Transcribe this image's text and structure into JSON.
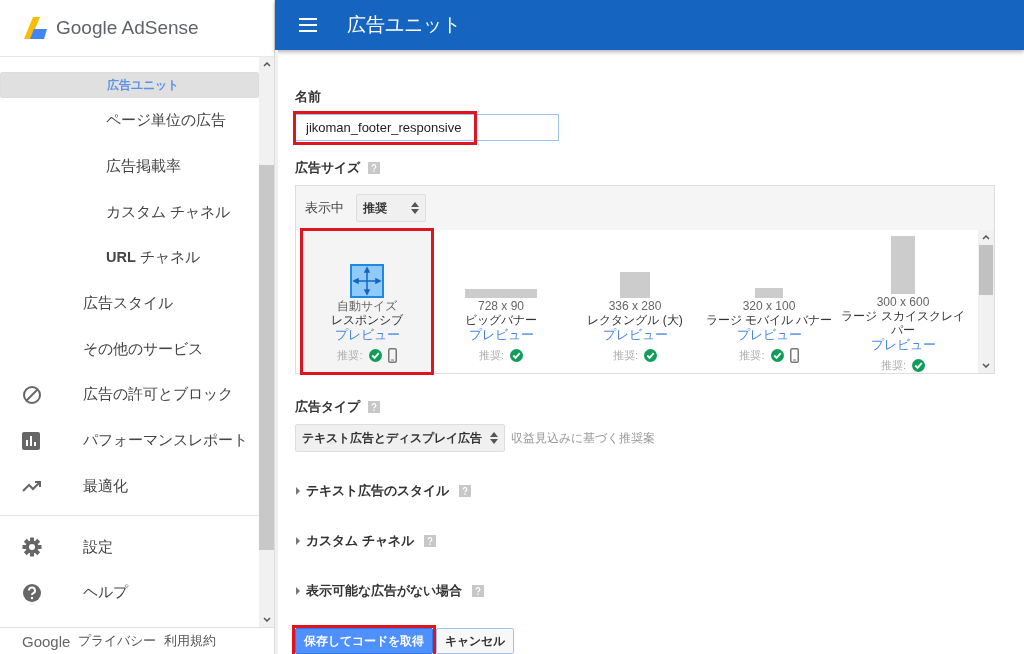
{
  "brand": {
    "name": "Google AdSense"
  },
  "header": {
    "title": "広告ユニット"
  },
  "sidebar": {
    "nav": [
      {
        "children": [
          {
            "label": "広告ユニット",
            "selected": true
          },
          {
            "label": "ページ単位の広告",
            "selected": false
          },
          {
            "label": "広告掲載率",
            "selected": false
          },
          {
            "label": "カスタム チャネル",
            "selected": false
          },
          {
            "label": "**URL** チャネル",
            "selected": false
          }
        ]
      },
      {
        "label": "広告スタイル",
        "selected": false
      },
      {
        "label": "その他のサービス",
        "selected": false
      },
      {
        "label": "広告の許可とブロック",
        "kind": "block",
        "selected": false
      },
      {
        "label": "パフォーマンスレポート",
        "kind": "chart",
        "selected": false
      },
      {
        "label": "最適化",
        "kind": "trend",
        "selected": false
      },
      {
        "kind": "divider"
      },
      {
        "label": "設定",
        "kind": "gear",
        "selected": false
      },
      {
        "label": "ヘルプ",
        "kind": "help",
        "selected": false
      }
    ],
    "footer": [
      "Google",
      "プライバシー",
      "利用規約"
    ]
  },
  "form": {
    "name": {
      "label": "名前",
      "value": "jikoman_footer_responsive",
      "highlighted": true
    },
    "ad_size": {
      "label": "広告サイズ",
      "filter_label": "表示中",
      "filter_value": "推奨",
      "items": [
        {
          "kind": "responsive",
          "size": "自動サイズ",
          "name": "レスポンシブ",
          "preview": "プレビュー",
          "recommended": "推奨:",
          "mobile": true,
          "highlighted": true
        },
        {
          "kind": "leaderboard",
          "size": "728 x 90",
          "name": "ビッグバナー",
          "preview": "プレビュー",
          "recommended": "推奨:",
          "mobile": false,
          "highlighted": false
        },
        {
          "kind": "rectangle",
          "size": "336 x 280",
          "name": "レクタングル (大)",
          "preview": "プレビュー",
          "recommended": "推奨:",
          "mobile": false,
          "highlighted": false
        },
        {
          "kind": "mobile-banner",
          "size": "320 x 100",
          "name": "ラージ モバイル バナー",
          "preview": "プレビュー",
          "recommended": "推奨:",
          "mobile": true,
          "highlighted": false
        },
        {
          "kind": "skyscraper",
          "size": "300 x 600",
          "name": "ラージ スカイスクレイパー",
          "preview": "プレビュー",
          "recommended": "推奨:",
          "mobile": false,
          "highlighted": false
        }
      ]
    },
    "ad_type": {
      "label": "広告タイプ",
      "value": "テキスト広告とディスプレイ広告",
      "hint": "収益見込みに基づく推奨案"
    },
    "sections": [
      {
        "label": "テキスト広告のスタイル",
        "expanded": false
      },
      {
        "label": "カスタム チャネル",
        "expanded": false
      },
      {
        "label": "表示可能な広告がない場合",
        "expanded": false
      }
    ],
    "buttons": [
      {
        "label": "保存してコードを取得",
        "kind": "primary",
        "highlighted": true
      },
      {
        "label": "キャンセル",
        "kind": "secondary",
        "highlighted": false
      }
    ]
  }
}
